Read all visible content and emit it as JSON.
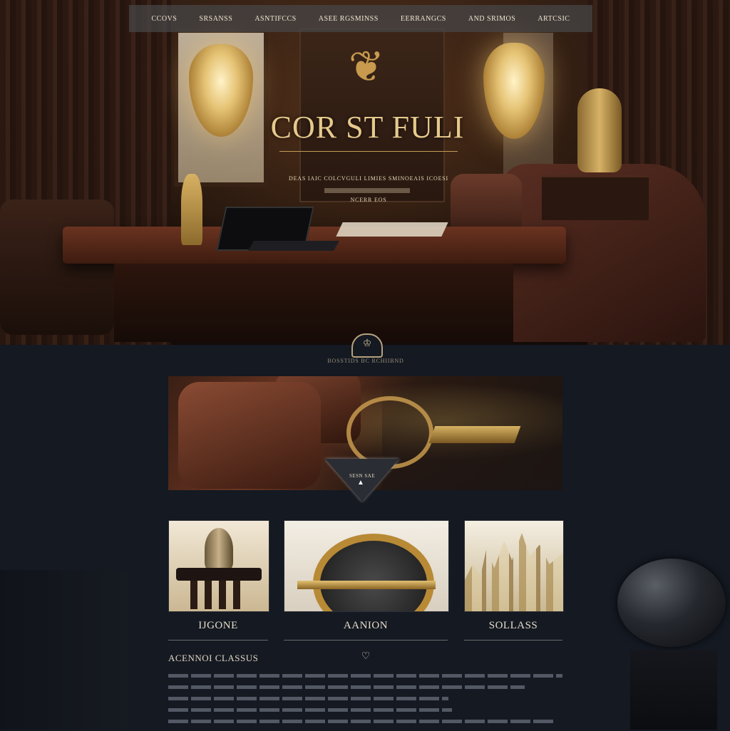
{
  "nav": {
    "items": [
      "CCOVS",
      "SRSANSS",
      "ASNTIFCCS",
      "ASEE RGSMINSS",
      "EERRANGCS",
      "AND SRIMOS",
      "ARTCSIC"
    ]
  },
  "hero": {
    "title": "COR ST FULI",
    "subtitle": "DEAS IAIC COLCVGULI LIMIES SMINOEAIS ICOESI",
    "cta": "NCERR EOS"
  },
  "emblem": {
    "caption": "BOSSTIDS BC RCHIIBND"
  },
  "feature": {
    "badge_label": "SESN SAE"
  },
  "cards": [
    {
      "label": "IJGONE"
    },
    {
      "label": "AANION"
    },
    {
      "label": "SOLLASS"
    }
  ],
  "section": {
    "heading": "ACENNOI CLASSUS",
    "body_line_count": 5
  },
  "colors": {
    "background": "#141922",
    "accent_gold": "#c49c55",
    "text_light": "#e6dcc8"
  },
  "icons": [
    "emblem-icon",
    "play-icon",
    "heart-icon"
  ]
}
